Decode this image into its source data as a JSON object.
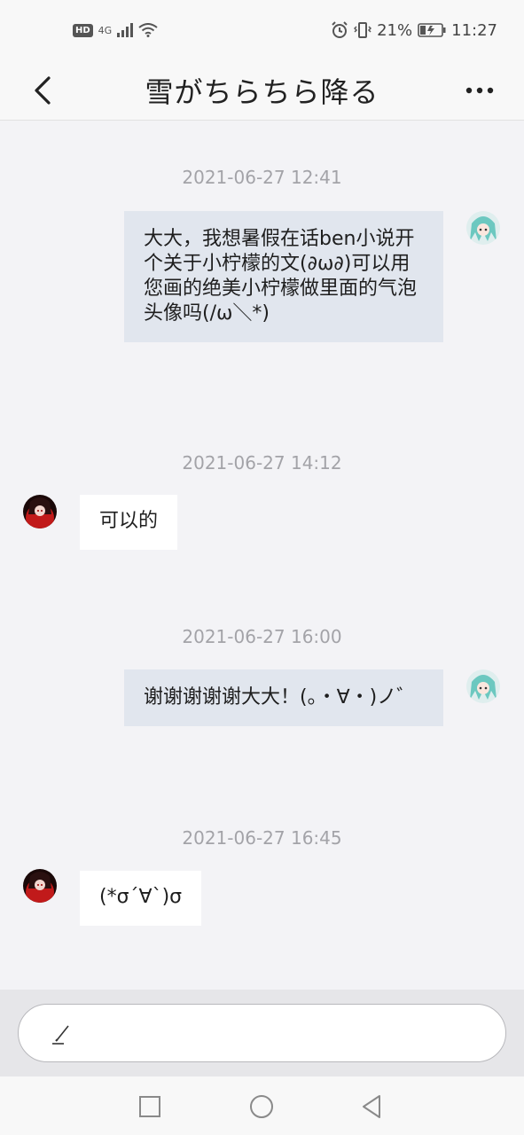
{
  "status_bar": {
    "hd": "HD",
    "signal": "4G",
    "battery_percent": "21%",
    "time": "11:27"
  },
  "header": {
    "title": "雪がちらちら降る"
  },
  "messages": [
    {
      "timestamp": "2021-06-27 12:41",
      "side": "right",
      "text": "大大，我想暑假在话ben小说开个关于小柠檬的文(∂ω∂)可以用您画的绝美小柠檬做里面的气泡头像吗(/ω＼*)"
    },
    {
      "timestamp": "2021-06-27 14:12",
      "side": "left",
      "text": "可以的"
    },
    {
      "timestamp": "2021-06-27 16:00",
      "side": "right",
      "text": "谢谢谢谢谢大大！(。・∀・)ノ゛"
    },
    {
      "timestamp": "2021-06-27 16:45",
      "side": "left",
      "text": "(*σ´∀`)σ"
    }
  ],
  "colors": {
    "background": "#f3f3f6",
    "outgoing_bubble": "#e1e6ee",
    "incoming_bubble": "#ffffff",
    "timestamp": "#a3a3a8"
  },
  "icons": {
    "back": "chevron-left-icon",
    "more": "more-dots-icon",
    "compose": "pen-icon",
    "nav_recent": "square-icon",
    "nav_home": "circle-icon",
    "nav_back": "triangle-left-icon"
  }
}
